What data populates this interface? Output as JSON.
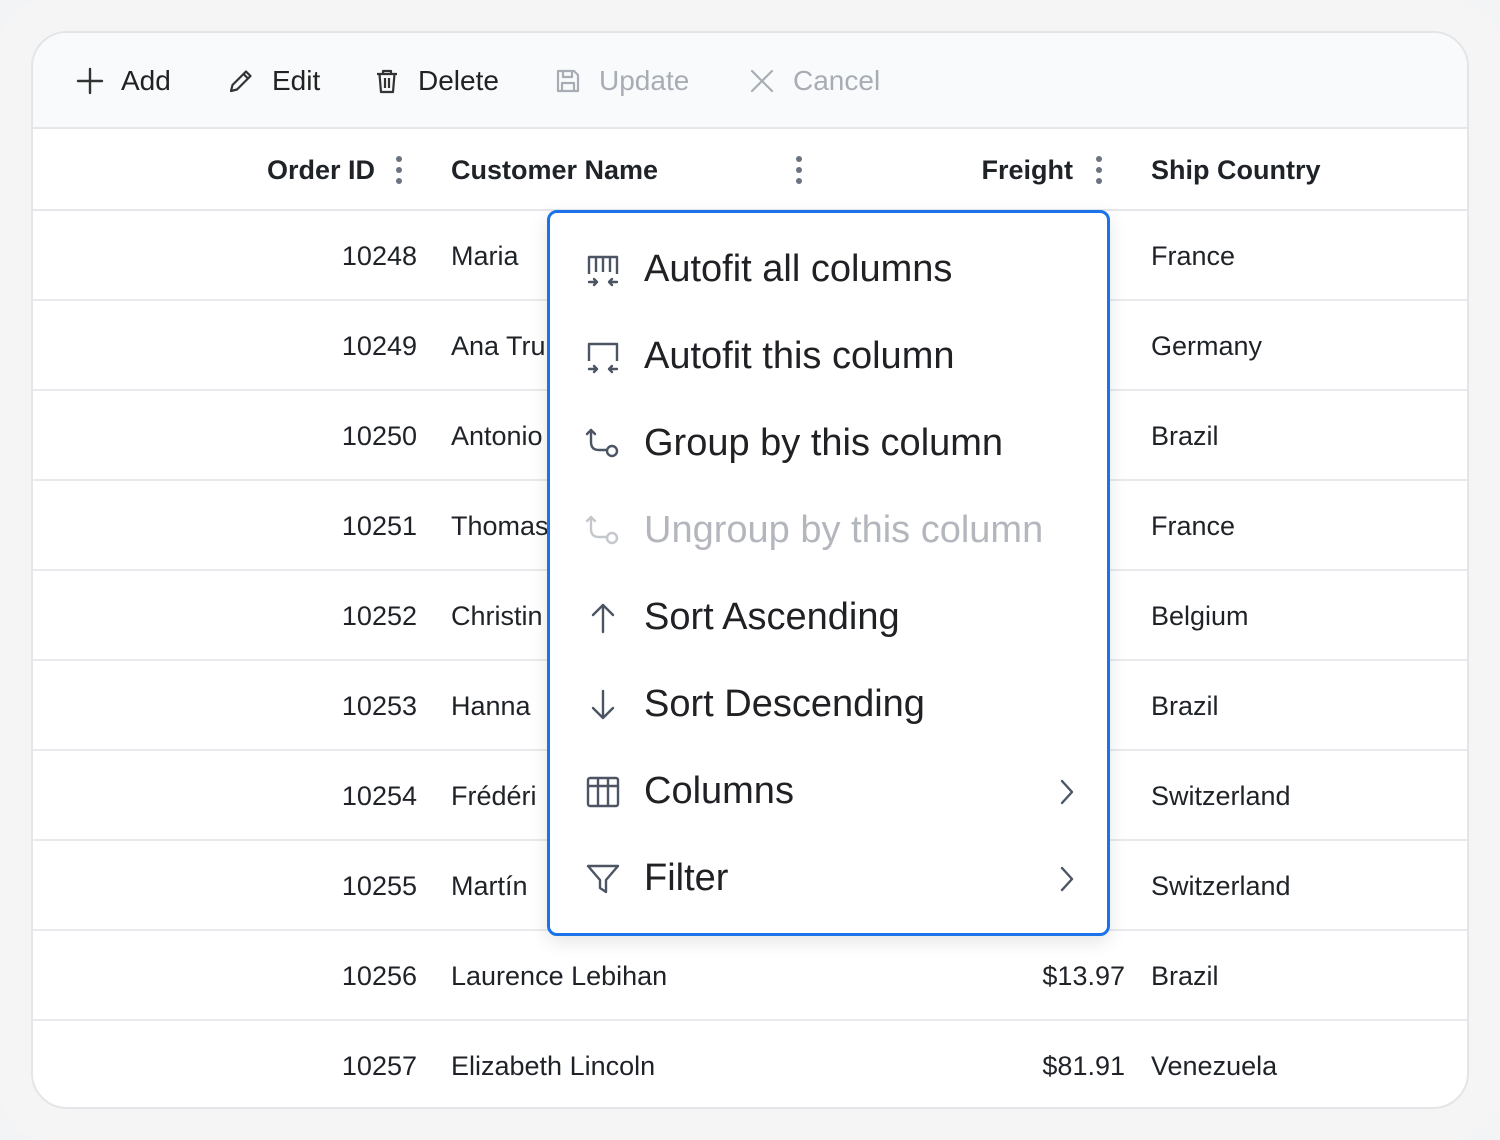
{
  "toolbar": {
    "add_label": "Add",
    "edit_label": "Edit",
    "delete_label": "Delete",
    "update_label": "Update",
    "cancel_label": "Cancel"
  },
  "columns": {
    "order_id": "Order ID",
    "customer_name": "Customer Name",
    "freight": "Freight",
    "ship_country": "Ship Country"
  },
  "rows": [
    {
      "order_id": "10248",
      "customer_name": "Maria",
      "freight": "",
      "ship_country": "France"
    },
    {
      "order_id": "10249",
      "customer_name": "Ana Tru",
      "freight": "",
      "ship_country": "Germany"
    },
    {
      "order_id": "10250",
      "customer_name": "Antonio",
      "freight": "",
      "ship_country": "Brazil"
    },
    {
      "order_id": "10251",
      "customer_name": "Thomas",
      "freight": "",
      "ship_country": "France"
    },
    {
      "order_id": "10252",
      "customer_name": "Christin",
      "freight": "",
      "ship_country": "Belgium"
    },
    {
      "order_id": "10253",
      "customer_name": "Hanna",
      "freight": "",
      "ship_country": "Brazil"
    },
    {
      "order_id": "10254",
      "customer_name": "Frédéri",
      "freight": "",
      "ship_country": "Switzerland"
    },
    {
      "order_id": "10255",
      "customer_name": "Martín",
      "freight": "",
      "ship_country": "Switzerland"
    },
    {
      "order_id": "10256",
      "customer_name": "Laurence Lebihan",
      "freight": "$13.97",
      "ship_country": "Brazil"
    },
    {
      "order_id": "10257",
      "customer_name": "Elizabeth Lincoln",
      "freight": "$81.91",
      "ship_country": "Venezuela"
    }
  ],
  "column_menu": {
    "items": [
      {
        "label": "Autofit all columns",
        "icon": "autofit-all-icon",
        "enabled": true,
        "submenu": false
      },
      {
        "label": "Autofit this column",
        "icon": "autofit-column-icon",
        "enabled": true,
        "submenu": false
      },
      {
        "label": "Group by this column",
        "icon": "group-icon",
        "enabled": true,
        "submenu": false
      },
      {
        "label": "Ungroup by this column",
        "icon": "ungroup-icon",
        "enabled": false,
        "submenu": false
      },
      {
        "label": "Sort Ascending",
        "icon": "arrow-up-icon",
        "enabled": true,
        "submenu": false
      },
      {
        "label": "Sort Descending",
        "icon": "arrow-down-icon",
        "enabled": true,
        "submenu": false
      },
      {
        "label": "Columns",
        "icon": "columns-icon",
        "enabled": true,
        "submenu": true
      },
      {
        "label": "Filter",
        "icon": "filter-icon",
        "enabled": true,
        "submenu": true
      }
    ]
  },
  "colors": {
    "accent": "#1a73e8",
    "text": "#1f2328",
    "disabled_text": "#a8adb5",
    "border": "#e5e7eb"
  }
}
